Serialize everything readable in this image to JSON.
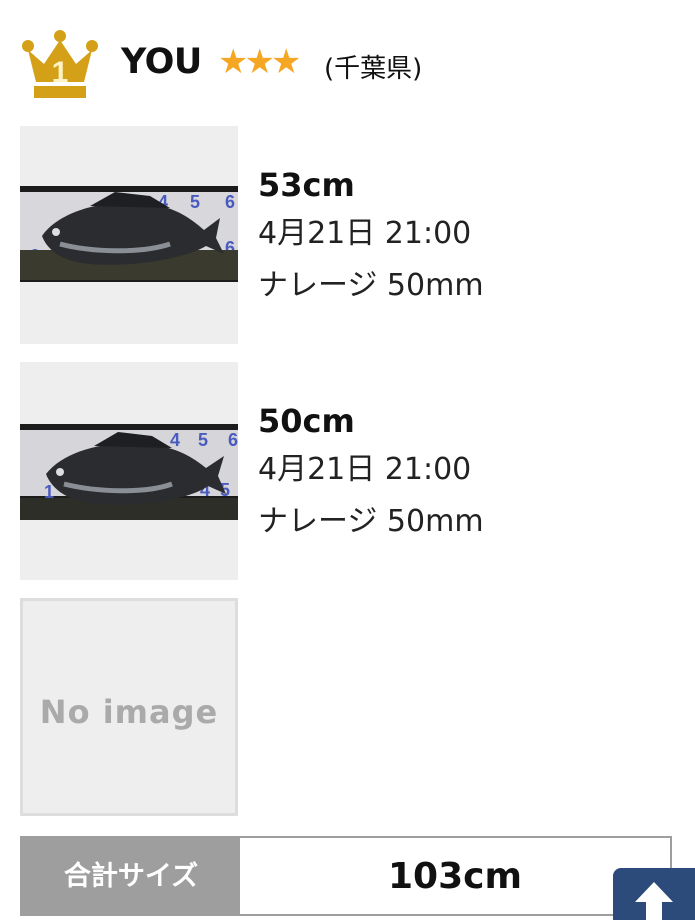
{
  "ranking": {
    "rank": "1",
    "user_name": "YOU",
    "stars": "★★★",
    "prefecture": "(千葉県)"
  },
  "entries": [
    {
      "size": "53cm",
      "datetime": "4月21日 21:00",
      "lure": "ナレージ 50mm",
      "has_image": true
    },
    {
      "size": "50cm",
      "datetime": "4月21日 21:00",
      "lure": "ナレージ 50mm",
      "has_image": true
    }
  ],
  "no_image": {
    "text": "No image"
  },
  "total": {
    "label": "合計サイズ",
    "value": "103cm"
  },
  "colors": {
    "star": "#f5a623",
    "crown": "#d4a017",
    "total_label_bg": "#9e9e9e",
    "page_top_bg": "#2c4a7a"
  },
  "icons": {
    "rank": "crown-icon",
    "page_top": "arrow-up-icon"
  }
}
